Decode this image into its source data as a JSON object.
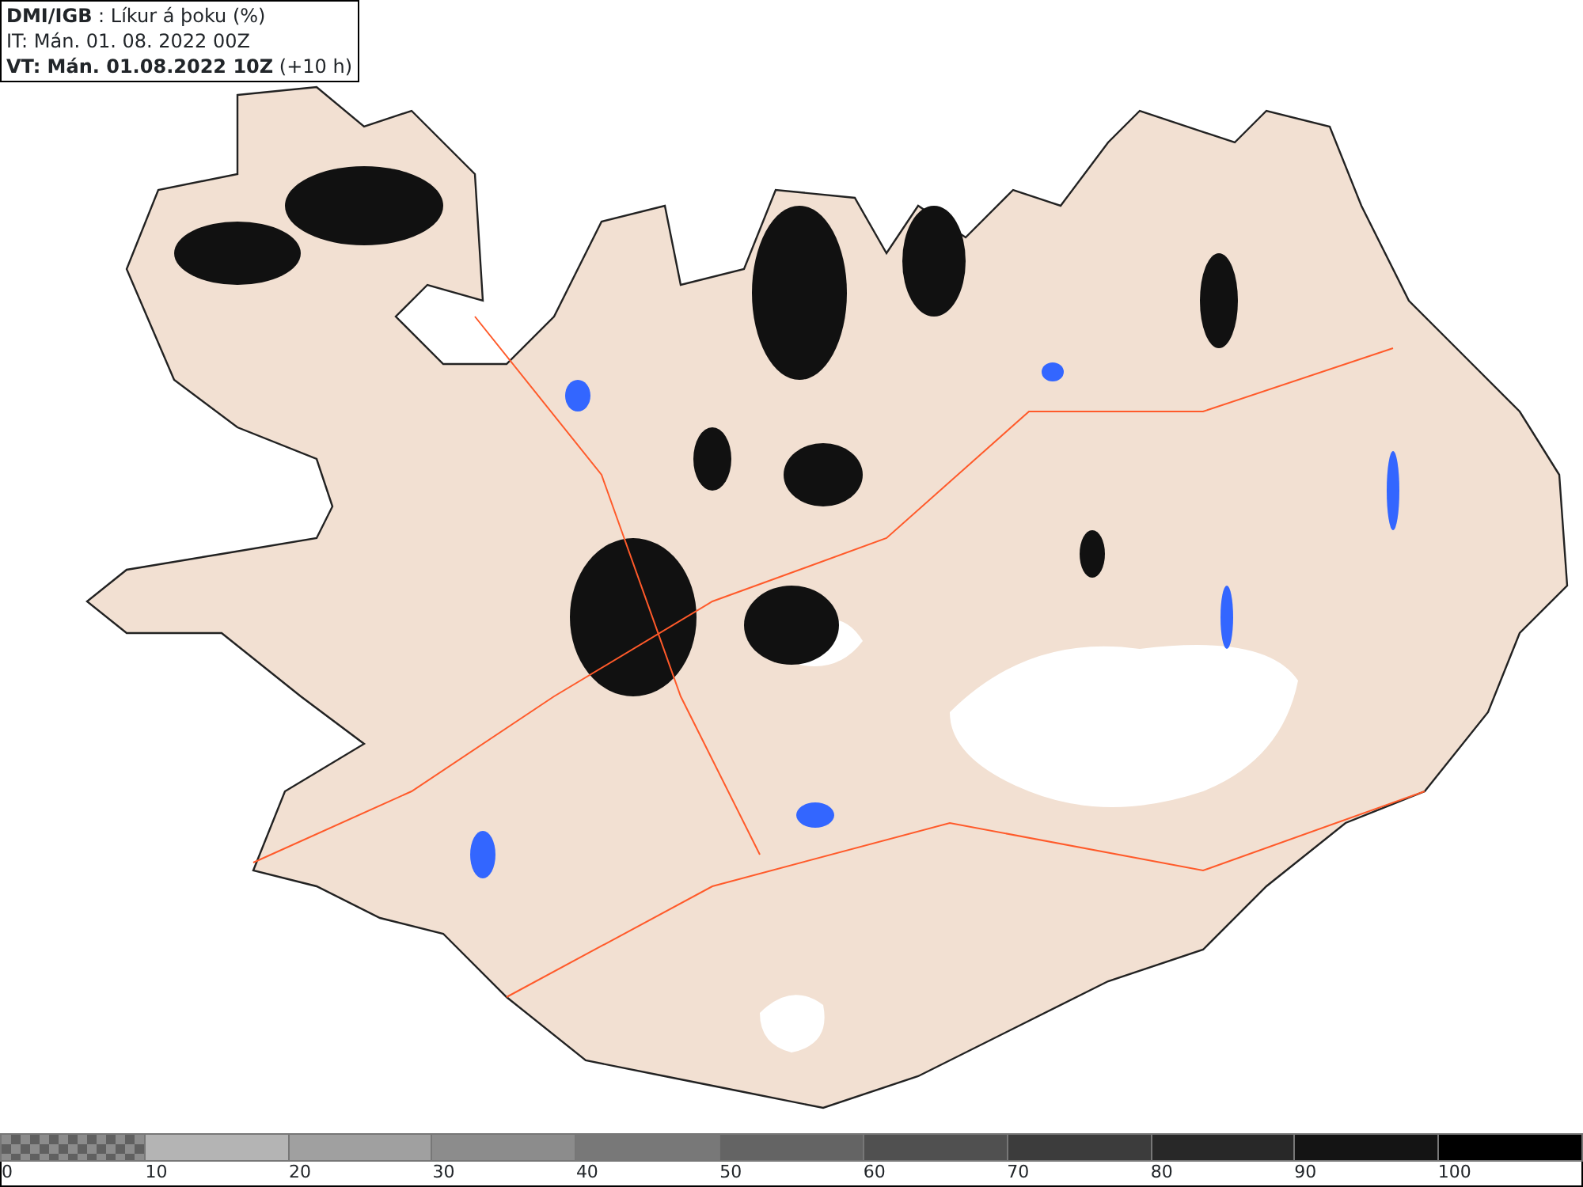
{
  "header": {
    "lines": [
      "**DMI/IGB** : Líkur á þoku (%)",
      "IT: Mán. 01. 08. 2022 00Z",
      "**VT: Mán. 01.08.2022 10Z** (+10 h)"
    ]
  },
  "legend": {
    "segments": [
      {
        "kind": "checker",
        "color": "#8c8c8c",
        "label": "0"
      },
      {
        "kind": "solid",
        "color": "#b4b4b4",
        "label": "10"
      },
      {
        "kind": "solid",
        "color": "#a0a0a0",
        "label": "20"
      },
      {
        "kind": "solid",
        "color": "#8c8c8c",
        "label": "30"
      },
      {
        "kind": "solid",
        "color": "#787878",
        "label": "40"
      },
      {
        "kind": "solid",
        "color": "#646464",
        "label": "50"
      },
      {
        "kind": "solid",
        "color": "#505050",
        "label": "60"
      },
      {
        "kind": "solid",
        "color": "#3c3c3c",
        "label": "70"
      },
      {
        "kind": "solid",
        "color": "#282828",
        "label": "80"
      },
      {
        "kind": "solid",
        "color": "#141414",
        "label": "90"
      },
      {
        "kind": "solid",
        "color": "#000000",
        "label": "100"
      }
    ]
  }
}
